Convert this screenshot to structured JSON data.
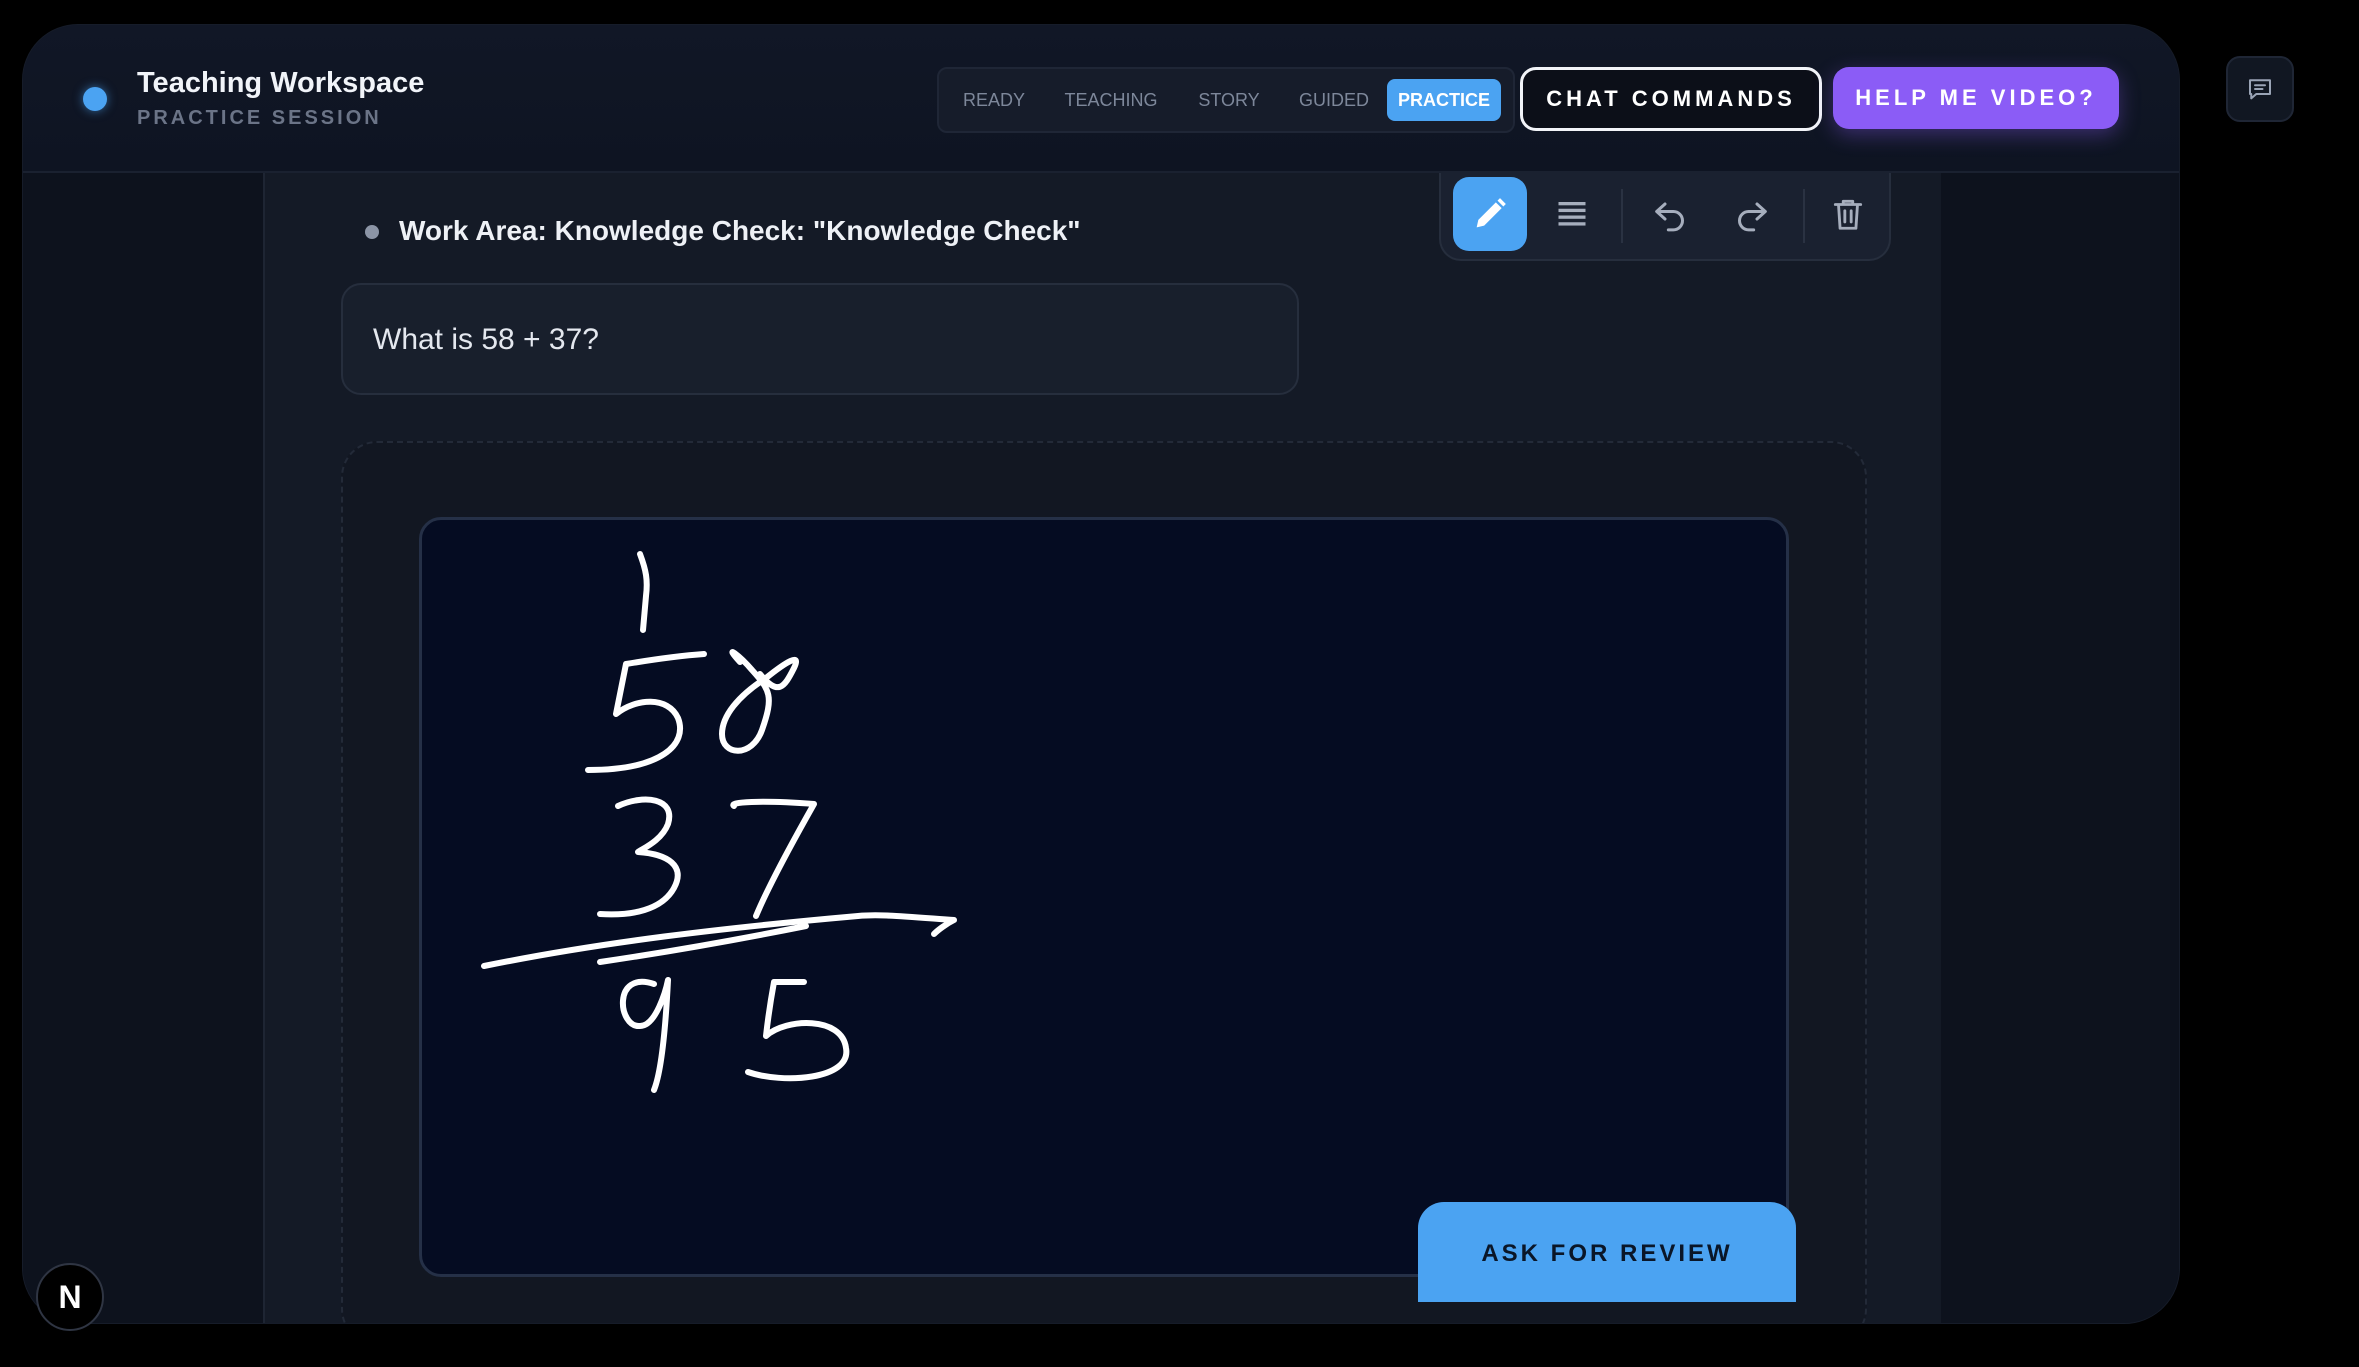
{
  "header": {
    "title": "Teaching Workspace",
    "subtitle": "PRACTICE SESSION",
    "modes": [
      {
        "label": "READY",
        "active": false
      },
      {
        "label": "TEACHING",
        "active": false
      },
      {
        "label": "STORY",
        "active": false
      },
      {
        "label": "GUIDED",
        "active": false
      },
      {
        "label": "PRACTICE",
        "active": true
      }
    ],
    "chat_commands_label": "CHAT COMMANDS",
    "help_video_label": "HELP ME VIDEO?"
  },
  "work_area": {
    "title": "Work Area: Knowledge Check: \"Knowledge Check\"",
    "question": "What is 58 + 37?"
  },
  "toolbar": {
    "tools": [
      "pencil-icon",
      "lines-icon",
      "undo-icon",
      "redo-icon",
      "trash-icon"
    ],
    "active_tool": "pencil-icon"
  },
  "review_button_label": "ASK FOR REVIEW",
  "corner_badge_label": "N",
  "colors": {
    "accent": "#4ba3f2",
    "help_button": "#8b5cf6",
    "canvas": "#050c22",
    "ink": "#ffffff"
  }
}
